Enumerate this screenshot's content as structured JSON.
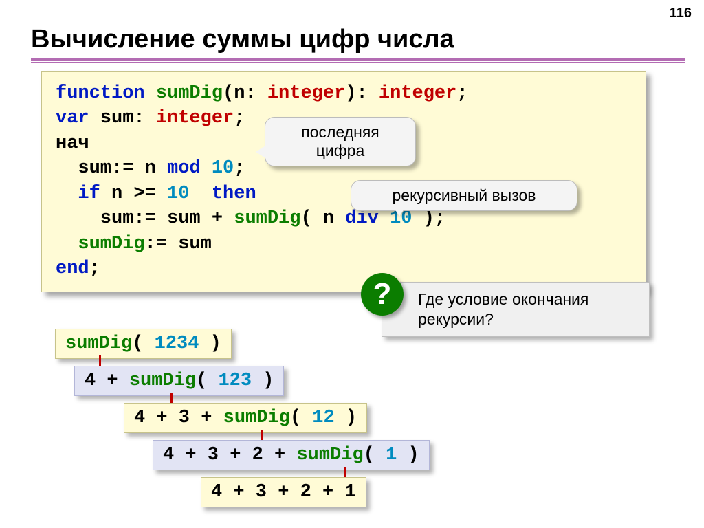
{
  "page_number": "116",
  "title": "Вычисление суммы цифр числа",
  "code": {
    "l1": {
      "kw": "function",
      "fn": "sumDig",
      "p1": "(n: ",
      "type1": "integer",
      "p2": "): ",
      "type2": "integer",
      "semi": ";"
    },
    "l2": {
      "kw": "var",
      "var": " sum: ",
      "type": "integer",
      "semi": ";"
    },
    "l3": "нач",
    "l4": {
      "a": "  sum:= n ",
      "kw": "mod",
      "sp": " ",
      "num": "10",
      "semi": ";"
    },
    "l5": {
      "a": "  ",
      "kw": "if",
      "b": " n >= ",
      "num": "10",
      "sp": "  ",
      "kw2": "then"
    },
    "l6": {
      "a": "    sum:= sum + ",
      "fn": "sumDig",
      "b": "( n ",
      "kw": "div",
      "sp": " ",
      "num": "10",
      "c": " );"
    },
    "l7": {
      "a": "  ",
      "fn": "sumDig",
      "b": ":= sum"
    },
    "l8": {
      "kw": "end",
      "semi": ";"
    }
  },
  "callouts": {
    "last_digit": "последняя цифра",
    "recursive_call": "рекурсивный вызов"
  },
  "question": "Где условие окончания рекурсии?",
  "question_mark": "?",
  "steps": {
    "s1": {
      "fn": "sumDig",
      "open": "( ",
      "num": "1234",
      "close": " )"
    },
    "s2": {
      "a": "4 + ",
      "fn": "sumDig",
      "open": "( ",
      "num": "123",
      "close": " )"
    },
    "s3": {
      "a": "4 + 3 + ",
      "fn": "sumDig",
      "open": "( ",
      "num": "12",
      "close": " )"
    },
    "s4": {
      "a": "4 + 3 + 2 + ",
      "fn": "sumDig",
      "open": "( ",
      "num": "1",
      "close": " )"
    },
    "s5": "4 + 3 + 2 + 1"
  }
}
